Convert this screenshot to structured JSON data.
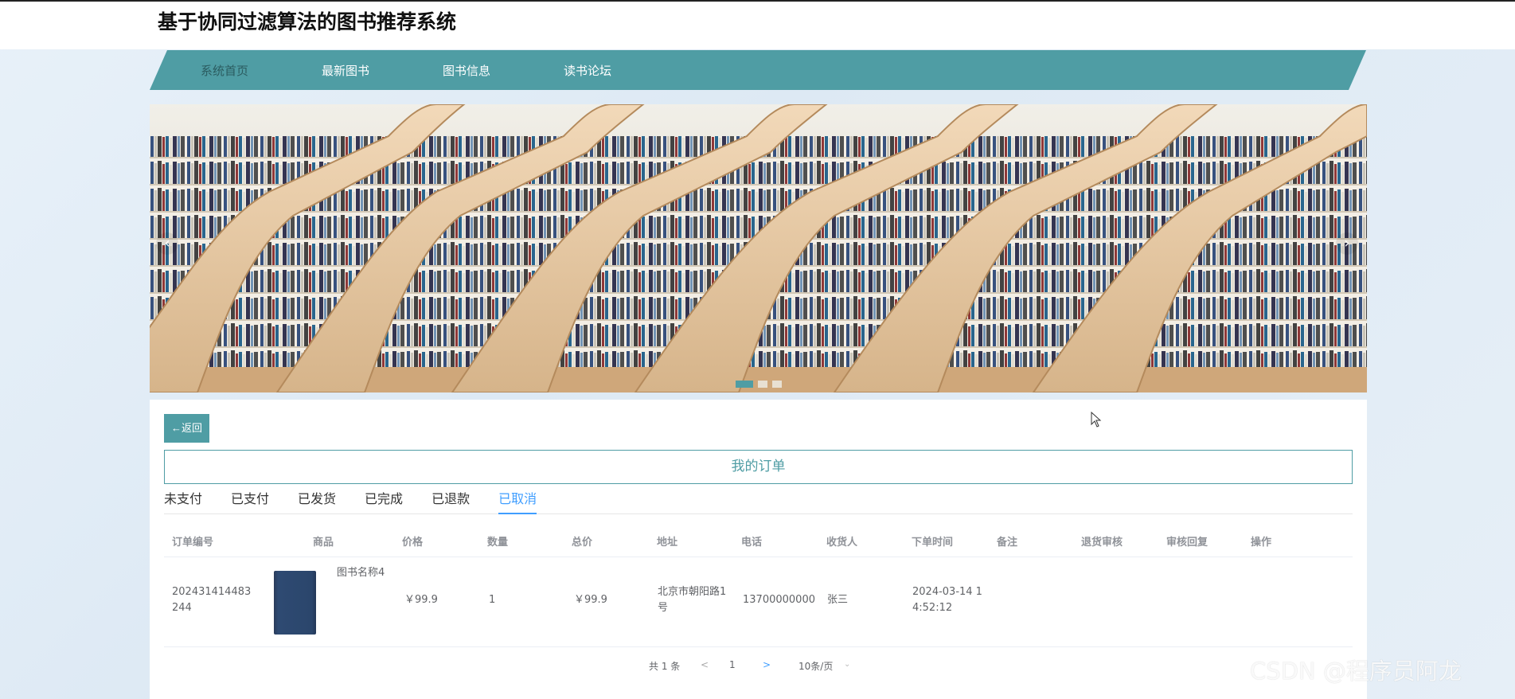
{
  "header": {
    "title": "基于协同过滤算法的图书推荐系统"
  },
  "nav": {
    "items": [
      {
        "label": "系统首页"
      },
      {
        "label": "最新图书"
      },
      {
        "label": "图书信息"
      },
      {
        "label": "读书论坛"
      }
    ]
  },
  "banner": {
    "prev": "‹",
    "next": "›"
  },
  "orders": {
    "back_label": "←返回",
    "title": "我的订单",
    "tabs": [
      {
        "label": "未支付"
      },
      {
        "label": "已支付"
      },
      {
        "label": "已发货"
      },
      {
        "label": "已完成"
      },
      {
        "label": "已退款"
      },
      {
        "label": "已取消"
      }
    ],
    "active_tab": "已取消",
    "columns": [
      "订单编号",
      "商品",
      "价格",
      "数量",
      "总价",
      "地址",
      "电话",
      "收货人",
      "下单时间",
      "备注",
      "退货审核",
      "审核回复",
      "操作"
    ],
    "rows": [
      {
        "order_no": "202431414483244",
        "product": "图书名称4",
        "price": "￥99.9",
        "quantity": "1",
        "total": "￥99.9",
        "address": "北京市朝阳路1号",
        "phone": "13700000000",
        "receiver": "张三",
        "order_time": "2024-03-14 14:52:12",
        "remark": "",
        "return_review": "",
        "review_reply": "",
        "actions": ""
      }
    ]
  },
  "pagination": {
    "total": "共 1 条",
    "prev": "<",
    "page": "1",
    "next": ">",
    "page_size": "10条/页"
  },
  "watermark": "CSDN @程序员阿龙",
  "colors": {
    "accent": "#4f9da4",
    "tab_active": "#409eff"
  }
}
